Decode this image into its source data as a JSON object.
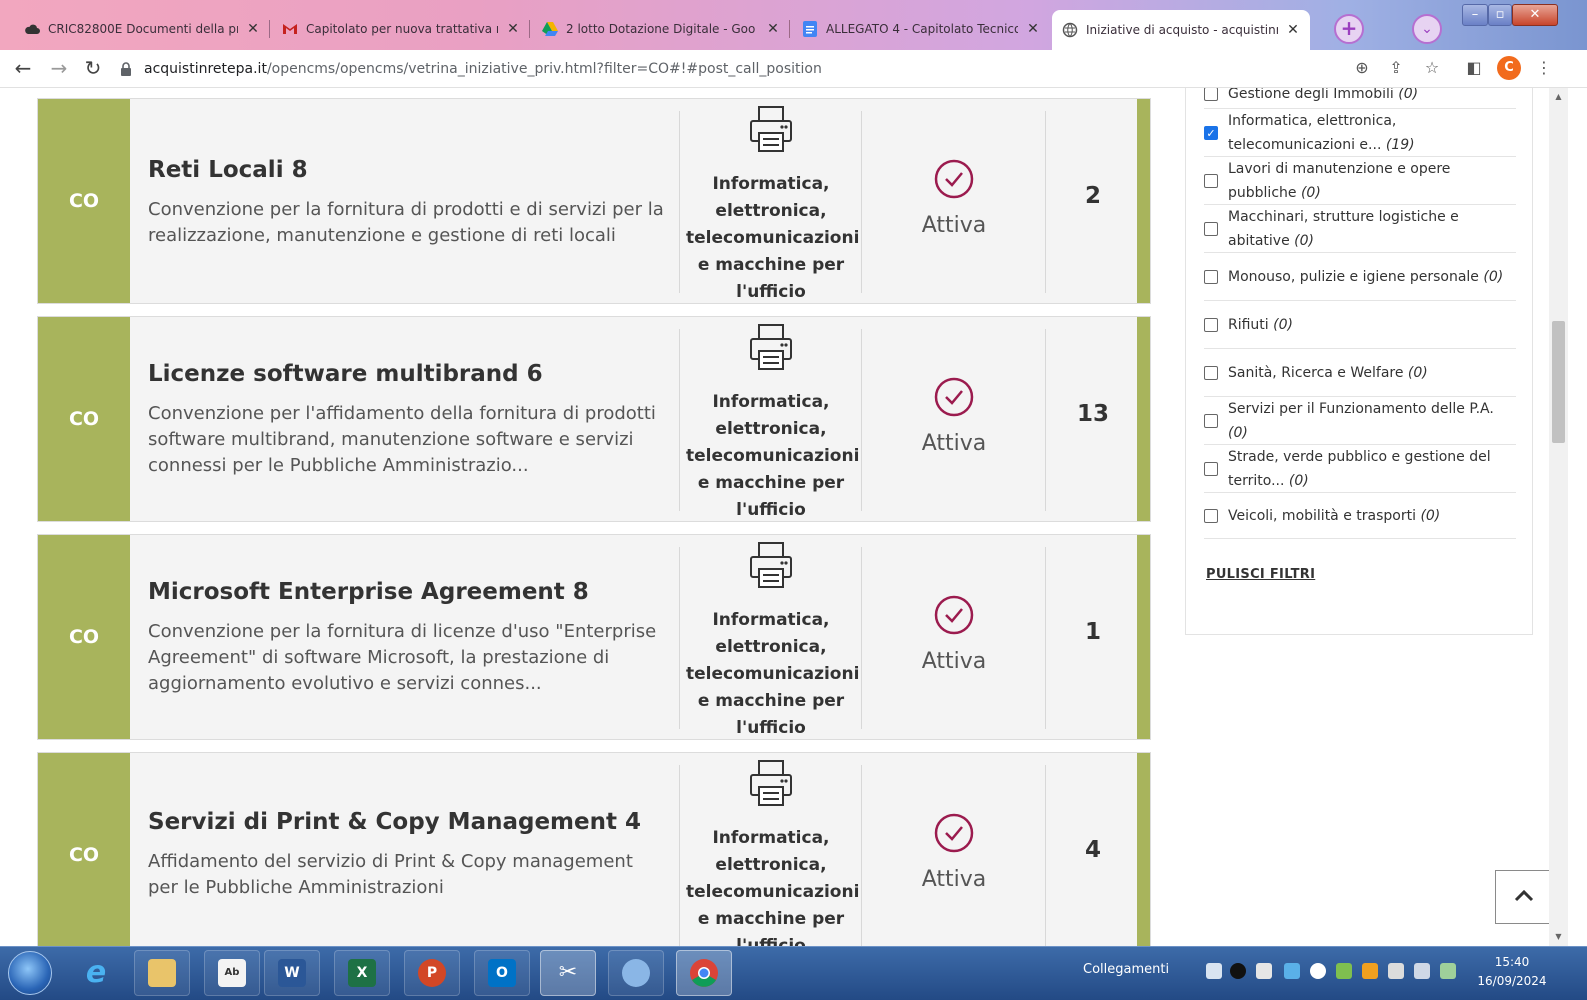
{
  "browser": {
    "tabs": [
      {
        "title": "CRIC82800E Documenti della pra",
        "favicon": "cloud-icon",
        "active": false
      },
      {
        "title": "Capitolato per nuova trattativa n",
        "favicon": "gmail-icon",
        "active": false
      },
      {
        "title": "2 lotto Dotazione Digitale - Goo",
        "favicon": "google-drive-icon",
        "active": false
      },
      {
        "title": "ALLEGATO 4 - Capitolato Tecnico",
        "favicon": "google-docs-icon",
        "active": false
      },
      {
        "title": "Iniziative di acquisto - acquistinr",
        "favicon": "globe-icon",
        "active": true
      }
    ],
    "url_domain": "acquistinretepa.it",
    "url_path": "/opencms/opencms/vetrina_iniziative_priv.html?filter=CO#!#post_call_position",
    "profile_initial": "C"
  },
  "initiatives": [
    {
      "badge": "CO",
      "title": "Reti Locali 8",
      "description": "Convenzione per la fornitura di prodotti e di servizi per la realizzazione, manutenzione e gestione di reti locali",
      "category": "Informatica, elettronica, telecomunicazioni e macchine per l'ufficio",
      "status": "Attiva",
      "count": "2"
    },
    {
      "badge": "CO",
      "title": "Licenze software multibrand 6",
      "description": "Convenzione per l'affidamento della fornitura di prodotti software multibrand, manutenzione software e servizi connessi per le Pubbliche Amministrazio...",
      "category": "Informatica, elettronica, telecomunicazioni e macchine per l'ufficio",
      "status": "Attiva",
      "count": "13"
    },
    {
      "badge": "CO",
      "title": "Microsoft Enterprise Agreement 8",
      "description": "Convenzione per la fornitura di licenze d'uso \"Enterprise Agreement\" di software Microsoft, la prestazione di aggiornamento evolutivo e servizi connes...",
      "category": "Informatica, elettronica, telecomunicazioni e macchine per l'ufficio",
      "status": "Attiva",
      "count": "1"
    },
    {
      "badge": "CO",
      "title": "Servizi di Print & Copy Management 4",
      "description": "Affidamento del servizio di Print & Copy management per le Pubbliche Amministrazioni",
      "category": "Informatica, elettronica, telecomunicazioni e macchine per l'ufficio",
      "status": "Attiva",
      "count": "4"
    }
  ],
  "filters": {
    "items": [
      {
        "label": "Gestione degli Immobili",
        "count": "(0)",
        "checked": false
      },
      {
        "label": "Informatica, elettronica, telecomunicazioni e...",
        "count": "(19)",
        "checked": true
      },
      {
        "label": "Lavori di manutenzione e opere pubbliche",
        "count": "(0)",
        "checked": false
      },
      {
        "label": "Macchinari, strutture logistiche e abitative",
        "count": "(0)",
        "checked": false
      },
      {
        "label": "Monouso, pulizie e igiene personale",
        "count": "(0)",
        "checked": false
      },
      {
        "label": "Rifiuti",
        "count": "(0)",
        "checked": false
      },
      {
        "label": "Sanità, Ricerca e Welfare",
        "count": "(0)",
        "checked": false
      },
      {
        "label": "Servizi per il Funzionamento delle P.A.",
        "count": "(0)",
        "checked": false
      },
      {
        "label": "Strade, verde pubblico e gestione del territo...",
        "count": "(0)",
        "checked": false
      },
      {
        "label": "Veicoli, mobilità e trasporti",
        "count": "(0)",
        "checked": false
      }
    ],
    "clear_label": "PULISCI FILTRI"
  },
  "colors": {
    "accent_green": "#a8b45c",
    "status_purple": "#9b1b4e"
  },
  "taskbar": {
    "apps": [
      "internet-explorer-icon",
      "file-explorer-icon",
      "notepad-icon",
      "word-icon",
      "excel-icon",
      "powerpoint-icon",
      "outlook-icon",
      "snipping-tool-icon",
      "paint-icon",
      "chrome-icon"
    ],
    "links_label": "Collegamenti",
    "time": "15:40",
    "date": "16/09/2024"
  }
}
